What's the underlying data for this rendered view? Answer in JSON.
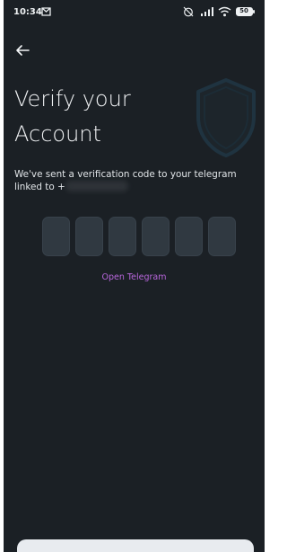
{
  "statusbar": {
    "time": "10:34",
    "battery": "50"
  },
  "header": {
    "back_icon": "arrow-left-icon"
  },
  "main": {
    "title_line1": "Verify your",
    "title_line2": "Account",
    "subtitle_prefix": "We've sent a verification code to your telegram",
    "subtitle_linked": "linked to +",
    "code_length": 6,
    "link_label": "Open Telegram"
  },
  "colors": {
    "background": "#1b2025",
    "link": "#b866dc",
    "code_box": "#303941",
    "shield": "#1f3340"
  }
}
